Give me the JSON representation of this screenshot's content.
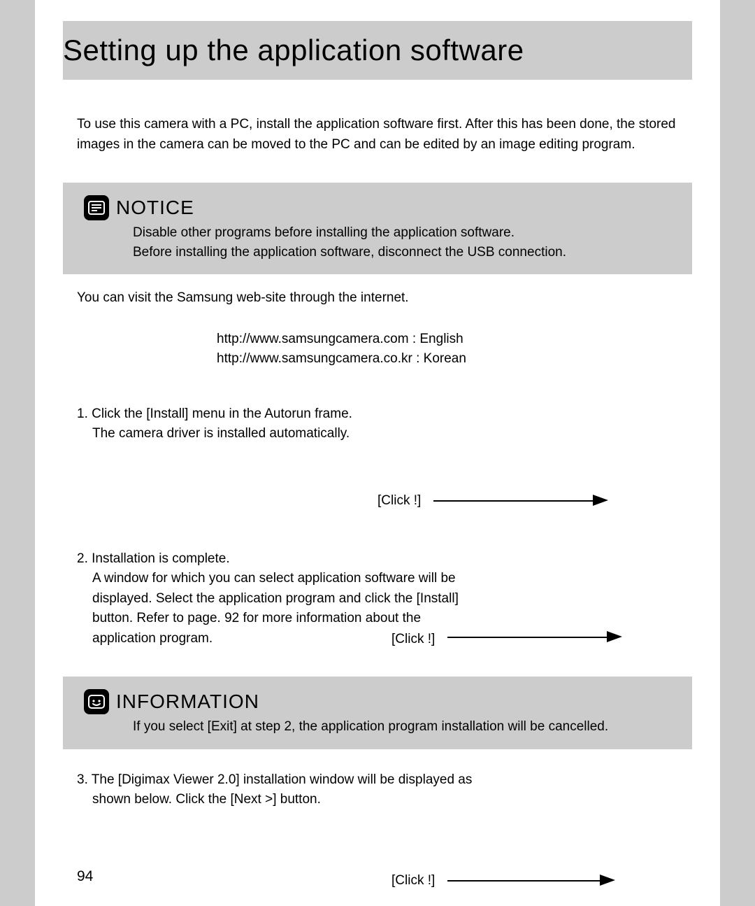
{
  "title": "Setting up the application software",
  "intro": "To use this camera with a PC, install the application software first. After this has been done, the stored images in the camera can be moved to the PC and can be edited by an image editing program.",
  "notice": {
    "heading": "NOTICE",
    "line1": "Disable other programs before installing the application software.",
    "line2": "Before installing the application software, disconnect the USB connection."
  },
  "websiteIntro": "You can visit the Samsung web-site through the internet.",
  "links": {
    "en": "http://www.samsungcamera.com  : English",
    "kr": "http://www.samsungcamera.co.kr  : Korean"
  },
  "step1": {
    "num": "1. Click the [Install] menu in the Autorun frame.",
    "line2": "The camera driver is installed automatically.",
    "click": "[Click !]"
  },
  "step2": {
    "num": "2. Installation is complete.",
    "line2": "A window for which you can select application software will be",
    "line3": "displayed. Select the application program and click the [Install]",
    "line4": "button. Refer to page. 92 for more information about the",
    "line5": "application program.",
    "click": "[Click !]"
  },
  "information": {
    "heading": "INFORMATION",
    "body": "If you select [Exit] at step 2, the application program installation will be cancelled."
  },
  "step3": {
    "num": "3. The [Digimax Viewer 2.0] installation window will be displayed as",
    "line2": "shown below. Click the [Next >] button.",
    "click": "[Click !]"
  },
  "pageNumber": "94"
}
